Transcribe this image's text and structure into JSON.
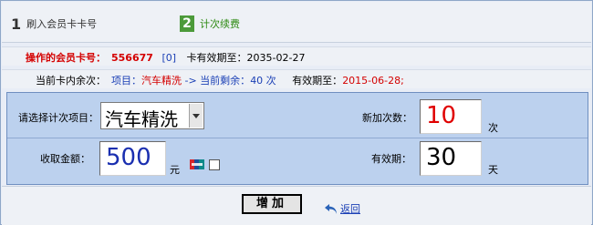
{
  "steps": [
    {
      "num": "1",
      "label": "刷入会员卡卡号"
    },
    {
      "num": "2",
      "label": "计次续费"
    }
  ],
  "info": {
    "card_label": "操作的会员卡号：",
    "card_number": "556677",
    "card_bracket": "[0]",
    "card_expiry_label": "卡有效期至：",
    "card_expiry": "2035-02-27",
    "remaining_label": "当前卡内余次：",
    "remaining_prefix": "项目：",
    "remaining_item": "汽车精洗",
    "remaining_arrow": " -> 当前剩余：",
    "remaining_count": "40 次",
    "remaining_expiry_label": "有效期至：",
    "remaining_expiry": "2015-06-28",
    "remaining_expiry_suffix": ";"
  },
  "form": {
    "item_label": "请选择计次项目：",
    "item_selected": "汽车精洗",
    "add_count_label": "新加次数：",
    "add_count_value": "10",
    "add_count_unit": "次",
    "amount_label": "收取金额：",
    "amount_value": "500",
    "amount_unit": "元",
    "validity_label": "有效期：",
    "validity_value": "30",
    "validity_unit": "天"
  },
  "actions": {
    "add_label": "增加",
    "back_label": "返回"
  },
  "colors": {
    "accent_red": "#d40000",
    "link_blue": "#1a3fb5",
    "step_green": "#4c9a3a",
    "form_bg": "#bcd1ee"
  }
}
